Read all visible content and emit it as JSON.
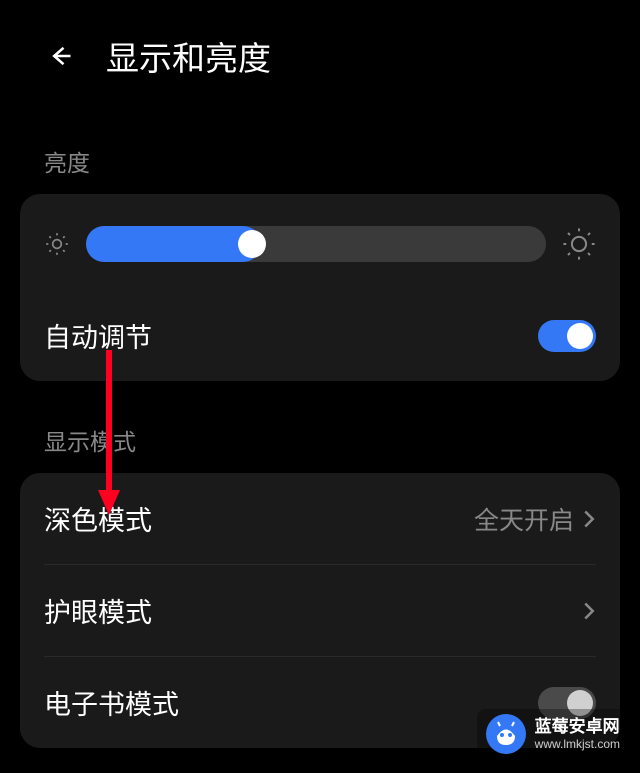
{
  "header": {
    "title": "显示和亮度"
  },
  "sections": {
    "brightness": {
      "label": "亮度",
      "auto_adjust": "自动调节"
    },
    "display_mode": {
      "label": "显示模式",
      "dark_mode": "深色模式",
      "dark_mode_value": "全天开启",
      "eye_care": "护眼模式",
      "ebook": "电子书模式"
    }
  },
  "watermark": {
    "title": "蓝莓安卓网",
    "url": "www.lmkjst.com"
  },
  "colors": {
    "accent": "#3478f6",
    "arrow": "#ff0020"
  }
}
